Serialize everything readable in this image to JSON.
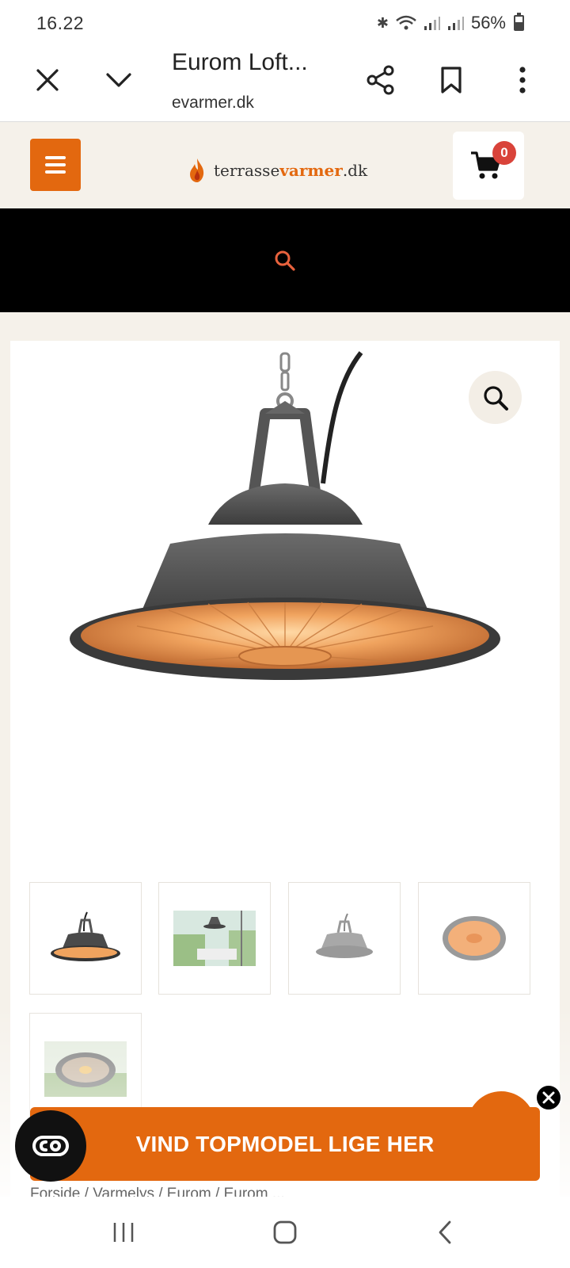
{
  "status_bar": {
    "time": "16.22",
    "battery": "56%"
  },
  "browser": {
    "title": "Eurom Loft...",
    "url": "evarmer.dk",
    "icons": [
      "close-icon",
      "chevron-down-icon",
      "share-icon",
      "bookmark-icon",
      "more-vert-icon"
    ]
  },
  "site": {
    "logo_prefix": "terrasse",
    "logo_accent": "varmer",
    "logo_suffix": ".dk",
    "cart_count": "0",
    "accent_color": "#e3680f",
    "badge_color": "#d9433a"
  },
  "gallery": {
    "thumbnails": [
      "thumb-1",
      "thumb-2",
      "thumb-3",
      "thumb-4",
      "thumb-5"
    ]
  },
  "cta": {
    "label": "VIND TOPMODEL LIGE HER"
  },
  "breadcrumb": {
    "peek": "Forside / Varmelys / Eurom / Eurom ..."
  }
}
